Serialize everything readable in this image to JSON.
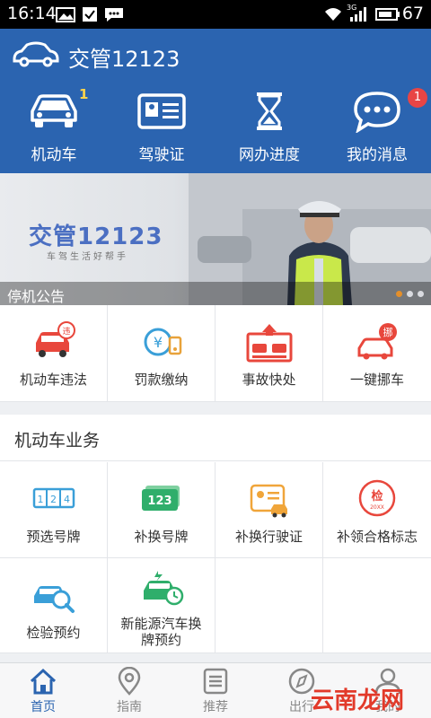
{
  "status_bar": {
    "time": "16:14",
    "network": "3G",
    "battery": "67"
  },
  "app_bar": {
    "title": "交管12123"
  },
  "quick_nav": [
    {
      "label": "机动车",
      "icon": "car-icon",
      "badge": "1"
    },
    {
      "label": "驾驶证",
      "icon": "license-card-icon"
    },
    {
      "label": "网办进度",
      "icon": "hourglass-icon"
    },
    {
      "label": "我的消息",
      "icon": "message-bubble-icon",
      "badge": "1"
    }
  ],
  "banner": {
    "brand": "交管12123",
    "slogan": "车驾生活好帮手",
    "caption": "停机公告",
    "dots": 3,
    "active_dot": 0
  },
  "services": [
    {
      "label": "机动车违法",
      "icon": "violation-car-icon"
    },
    {
      "label": "罚款缴纳",
      "icon": "fine-payment-icon"
    },
    {
      "label": "事故快处",
      "icon": "accident-icon"
    },
    {
      "label": "一键挪车",
      "icon": "move-car-icon"
    }
  ],
  "vehicle_section": {
    "title": "机动车业务",
    "items": [
      {
        "label": "预选号牌",
        "icon": "plate-number-icon"
      },
      {
        "label": "补换号牌",
        "icon": "replace-plate-icon"
      },
      {
        "label": "补换行驶证",
        "icon": "driving-permit-icon"
      },
      {
        "label": "补领合格标志",
        "icon": "inspection-mark-icon"
      },
      {
        "label": "检验预约",
        "icon": "inspection-booking-icon"
      },
      {
        "label": "新能源汽车换牌预约",
        "icon": "new-energy-car-icon"
      }
    ]
  },
  "tab_bar": [
    {
      "label": "首页",
      "icon": "home-icon",
      "active": true
    },
    {
      "label": "指南",
      "icon": "location-pin-icon"
    },
    {
      "label": "推荐",
      "icon": "list-icon"
    },
    {
      "label": "出行",
      "icon": "compass-icon"
    },
    {
      "label": "我的",
      "icon": "user-icon"
    }
  ],
  "watermark": "云南龙网",
  "colors": {
    "primary": "#2b64b0",
    "accent_red": "#e84545",
    "badge_yellow": "#ffd44a",
    "tab_active": "#2b64b0"
  }
}
